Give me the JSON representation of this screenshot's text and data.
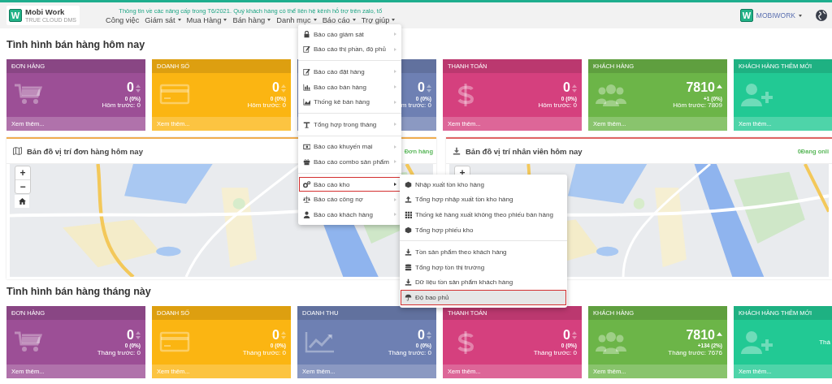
{
  "topbar": {
    "logo": {
      "mark": "W",
      "name": "Mobi Work",
      "tagline": "TRUE CLOUD DMS"
    },
    "notice": "Thông tin về các nâng cấp trong T6/2021. Quý khách hàng có thể liên hệ kênh hỗ trợ trên zalo, tổ",
    "nav": [
      {
        "label": "Công việc",
        "dropdown": false
      },
      {
        "label": "Giám sát",
        "dropdown": true
      },
      {
        "label": "Mua Hàng",
        "dropdown": true
      },
      {
        "label": "Bán hàng",
        "dropdown": true
      },
      {
        "label": "Danh mục",
        "dropdown": true
      },
      {
        "label": "Báo cáo",
        "dropdown": true
      },
      {
        "label": "Trợ giúp",
        "dropdown": true
      }
    ],
    "account": {
      "mark": "W",
      "name": "MOBIWORK"
    }
  },
  "today": {
    "title": "Tình hình bán hàng hôm nay",
    "cards": [
      {
        "title": "ĐƠN HÀNG",
        "value": "0",
        "change": "0 (0%)",
        "previous": "Hôm trước: 0",
        "link": "Xem thêm...",
        "color": "#9c4f96",
        "rising": false
      },
      {
        "title": "DOANH SỐ",
        "value": "0",
        "change": "0 (0%)",
        "previous": "Hôm trước: 0",
        "link": "Xem thêm...",
        "color": "#fbb512",
        "rising": false
      },
      {
        "value": "0",
        "change": "0 (0%)",
        "previous": "m trước: 0",
        "color": "#6e80b3",
        "rising": false
      },
      {
        "title": "THANH TOÁN",
        "value": "0",
        "change": "0 (0%)",
        "previous": "Hôm trước: 0",
        "link": "Xem thêm...",
        "color": "#d5407e",
        "rising": false
      },
      {
        "title": "KHÁCH HÀNG",
        "value": "7810",
        "change": "+1 (0%)",
        "previous": "Hôm trước: 7809",
        "link": "Xem thêm...",
        "color": "#6cb548",
        "rising": true
      },
      {
        "title": "KHÁCH HÀNG THÊM MỚI",
        "link": "Xem thêm...",
        "color": "#22c994"
      }
    ]
  },
  "maps": [
    {
      "title": "Bản đồ vị trí đơn hàng hôm nay",
      "status": "Đơn hàng",
      "color": "#f0ad4e",
      "zoom_in": "+",
      "zoom_out": "−"
    },
    {
      "title": "Bản đồ vị trí nhân viên hôm nay",
      "status": "0Đang onli",
      "color": "#e06464",
      "zoom_in": "+"
    }
  ],
  "month": {
    "title": "Tình hình bán hàng tháng này",
    "cards": [
      {
        "title": "ĐƠN HÀNG",
        "value": "0",
        "change": "0 (0%)",
        "previous": "Tháng trước: 0",
        "link": "Xem thêm...",
        "color": "#9c4f96",
        "rising": false
      },
      {
        "title": "DOANH SỐ",
        "value": "0",
        "change": "0 (0%)",
        "previous": "Tháng trước: 0",
        "link": "Xem thêm...",
        "color": "#fbb512",
        "rising": false
      },
      {
        "title": "DOANH THU",
        "value": "0",
        "change": "0 (0%)",
        "previous": "Tháng trước: 0",
        "link": "Xem thêm...",
        "color": "#6e80b3",
        "rising": false
      },
      {
        "title": "THANH TOÁN",
        "value": "0",
        "change": "0 (0%)",
        "previous": "Tháng trước: 0",
        "link": "Xem thêm...",
        "color": "#d5407e",
        "rising": false
      },
      {
        "title": "KHÁCH HÀNG",
        "value": "7810",
        "change": "+134 (2%)",
        "previous": "Tháng trước: 7676",
        "link": "Xem thêm...",
        "color": "#6cb548",
        "rising": true
      },
      {
        "title": "KHÁCH HÀNG THÊM MỚI",
        "previous": "Thá",
        "link": "Xem thêm...",
        "color": "#22c994"
      }
    ]
  },
  "report_menu": {
    "groups": [
      [
        {
          "label": "Báo cáo giám sát",
          "open": false
        },
        {
          "label": "Báo cáo thị phần, độ phủ",
          "open": false
        }
      ],
      [
        {
          "label": "Báo cáo đặt hàng",
          "open": false
        },
        {
          "label": "Báo cáo bán hàng",
          "open": false
        },
        {
          "label": "Thống kê bán hàng",
          "open": false
        }
      ],
      [
        {
          "label": "Tổng hợp trong tháng",
          "open": false
        }
      ],
      [
        {
          "label": "Báo cáo khuyến mại",
          "open": false
        },
        {
          "label": "Báo cáo combo sản phẩm",
          "open": false
        }
      ],
      [
        {
          "label": "Báo cáo kho",
          "open": true
        },
        {
          "label": "Báo cáo công nợ",
          "open": false
        },
        {
          "label": "Báo cáo khách hàng",
          "open": false
        }
      ]
    ]
  },
  "stock_submenu": {
    "groups": [
      [
        {
          "label": "Nhập xuất tồn kho hàng",
          "selected": false
        },
        {
          "label": "Tổng hợp nhập xuất tồn kho hàng",
          "selected": false
        },
        {
          "label": "Thống kê hàng xuất không theo phiếu bán hàng",
          "selected": false
        },
        {
          "label": "Tổng hợp phiếu kho",
          "selected": false
        }
      ],
      [
        {
          "label": "Tồn sản phẩm theo khách hàng",
          "selected": false
        },
        {
          "label": "Tổng hợp tồn thị trường",
          "selected": false
        },
        {
          "label": "Dữ liệu tồn sản phẩm khách hàng",
          "selected": false
        },
        {
          "label": "Độ bao phủ",
          "selected": true
        }
      ]
    ]
  }
}
